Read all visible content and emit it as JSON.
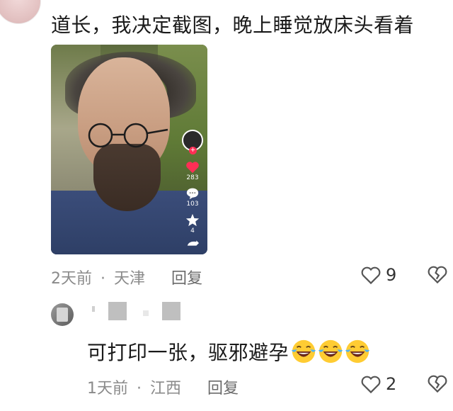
{
  "comments": [
    {
      "text": "道长，我决定截图，晚上睡觉放床头看着",
      "time": "2天前",
      "location": "天津",
      "reply_label": "回复",
      "like_count": "9",
      "video": {
        "side": [
          {
            "icon": "heart-icon",
            "count": "283"
          },
          {
            "icon": "comment-icon",
            "count": "103"
          },
          {
            "icon": "star-icon",
            "count": "4"
          }
        ]
      }
    },
    {
      "text": "可打印一张，驱邪避孕",
      "emoji": "laughing-tears-icon",
      "time": "1天前",
      "location": "江西",
      "reply_label": "回复",
      "like_count": "2"
    }
  ],
  "separator": "·",
  "colors": {
    "meta": "#8a8a8a",
    "heart": "#ff2e55",
    "robe": "#2e3f66"
  }
}
